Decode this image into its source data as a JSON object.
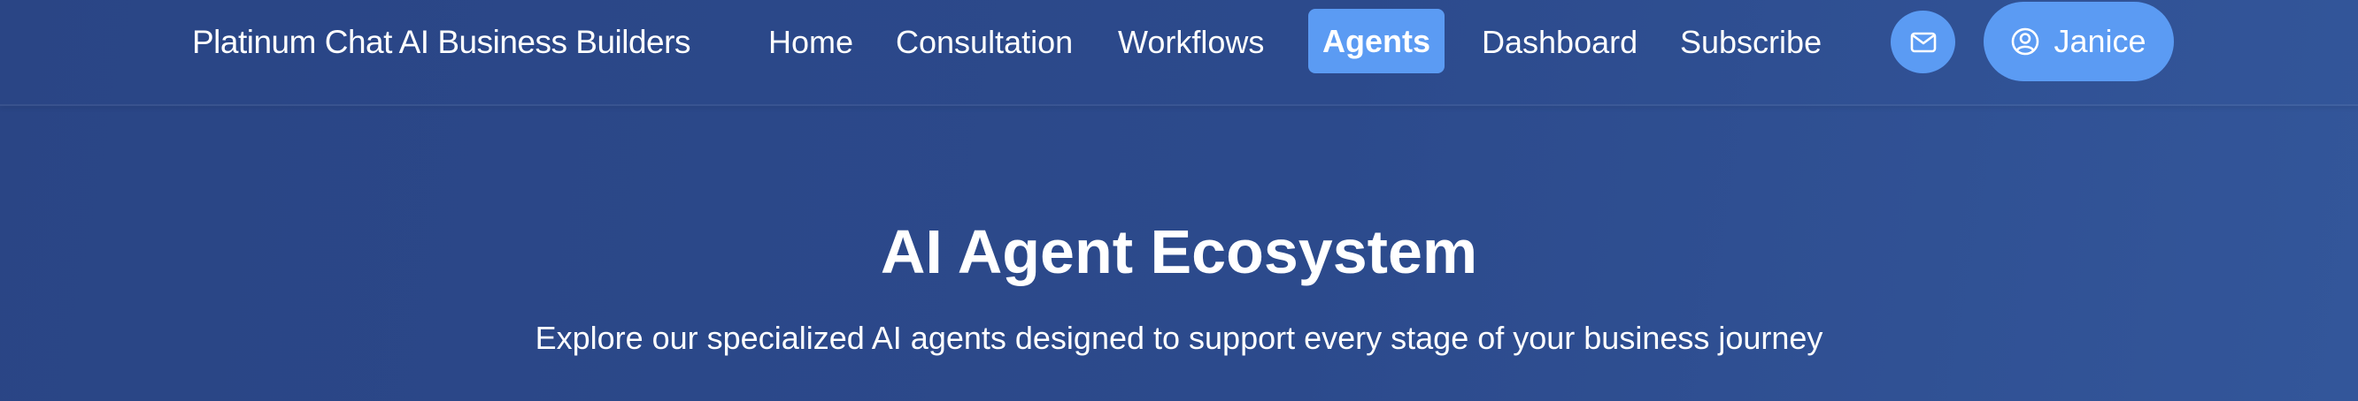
{
  "header": {
    "brand": "Platinum Chat AI Business Builders",
    "nav": [
      {
        "label": "Home",
        "active": false
      },
      {
        "label": "Consultation",
        "active": false
      },
      {
        "label": "Workflows",
        "active": false
      },
      {
        "label": "Agents",
        "active": true
      },
      {
        "label": "Dashboard",
        "active": false
      },
      {
        "label": "Subscribe",
        "active": false
      }
    ],
    "mail_icon": "envelope-icon",
    "user": {
      "icon": "user-circle-icon",
      "name": "Janice"
    }
  },
  "hero": {
    "title": "AI Agent Ecosystem",
    "subtitle": "Explore our specialized AI agents designed to support every stage of your business journey"
  },
  "colors": {
    "background": "#2c4a8c",
    "accent": "#5b9bf3",
    "text": "#ffffff"
  }
}
